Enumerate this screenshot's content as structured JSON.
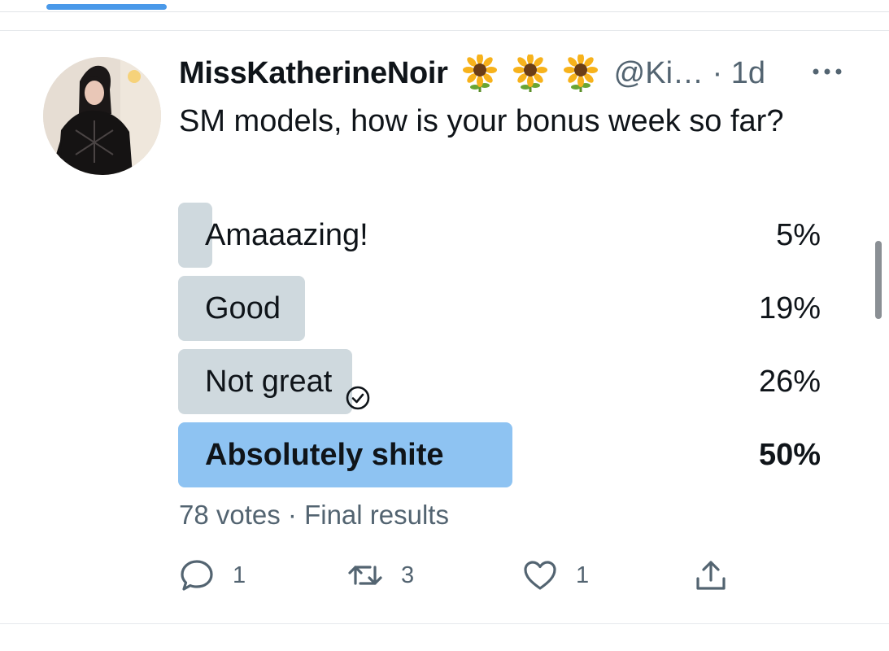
{
  "tweet": {
    "display_name": "MissKatherineNoir",
    "name_emojis": [
      "sunflower-icon",
      "sunflower-icon",
      "sunflower-icon"
    ],
    "handle_time": "@Ki… · 1d",
    "text": "SM models, how is your bonus week so far?"
  },
  "poll": {
    "options": [
      {
        "label": "Amaaazing!",
        "percent_text": "5%",
        "percent": 5
      },
      {
        "label": "Good",
        "percent_text": "19%",
        "percent": 19
      },
      {
        "label": "Not great",
        "percent_text": "26%",
        "percent": 26
      },
      {
        "label": "Absolutely shite",
        "percent_text": "50%",
        "percent": 50
      }
    ],
    "summary": "78 votes · Final results"
  },
  "actions": {
    "replies": "1",
    "retweets": "3",
    "likes": "1"
  },
  "colors": {
    "accent": "#1d9bf0",
    "poll_bar": "#cfd9de",
    "poll_bar_winner": "#8ec3f2",
    "secondary_text": "#536471"
  }
}
